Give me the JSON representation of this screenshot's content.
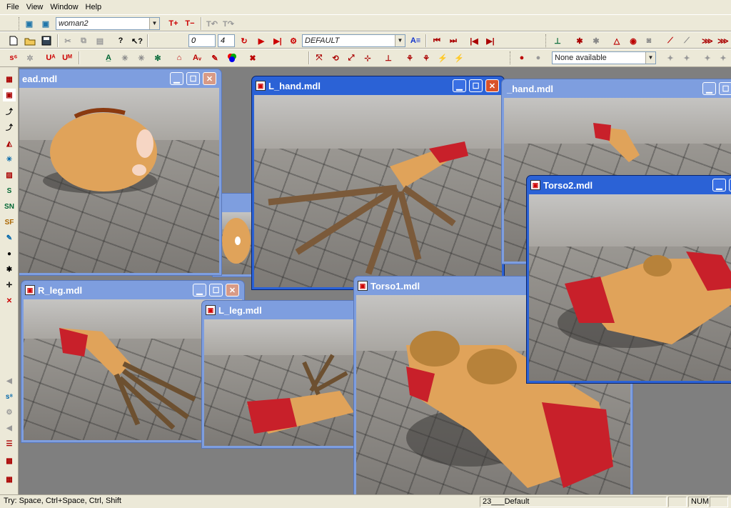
{
  "menu": {
    "file": "File",
    "view": "View",
    "window": "Window",
    "help": "Help"
  },
  "toolbar1": {
    "model_combo": "woman2"
  },
  "toolbar2": {
    "frame_start": "0",
    "frame_end": "4",
    "animation_combo": "DEFAULT"
  },
  "toolbar3": {
    "selection_combo": "None available"
  },
  "windows": {
    "head": {
      "title": "ead.mdl"
    },
    "l_hand": {
      "title": "L_hand.mdl"
    },
    "r_hand": {
      "title": "_hand.mdl"
    },
    "torso2": {
      "title": "Torso2.mdl"
    },
    "r_leg": {
      "title": "R_leg.mdl"
    },
    "l_leg": {
      "title": "L_leg.mdl"
    },
    "torso1": {
      "title": "Torso1.mdl"
    }
  },
  "status": {
    "hint": "Try: Space, Ctrl+Space, Ctrl, Shift",
    "frame_info": "23___Default",
    "num": "NUM"
  },
  "colors": {
    "title_active": "#2b62d6",
    "title_inactive": "#7e9edf",
    "skin": "#e0a35a",
    "blood": "#c8202a"
  },
  "icons": [
    "new-file-icon",
    "open-folder-icon",
    "save-icon",
    "cut-icon",
    "copy-icon",
    "paste-icon",
    "help-icon",
    "play-icon",
    "skip-start-icon",
    "skip-end-icon",
    "minimize-icon",
    "maximize-icon",
    "close-icon"
  ]
}
